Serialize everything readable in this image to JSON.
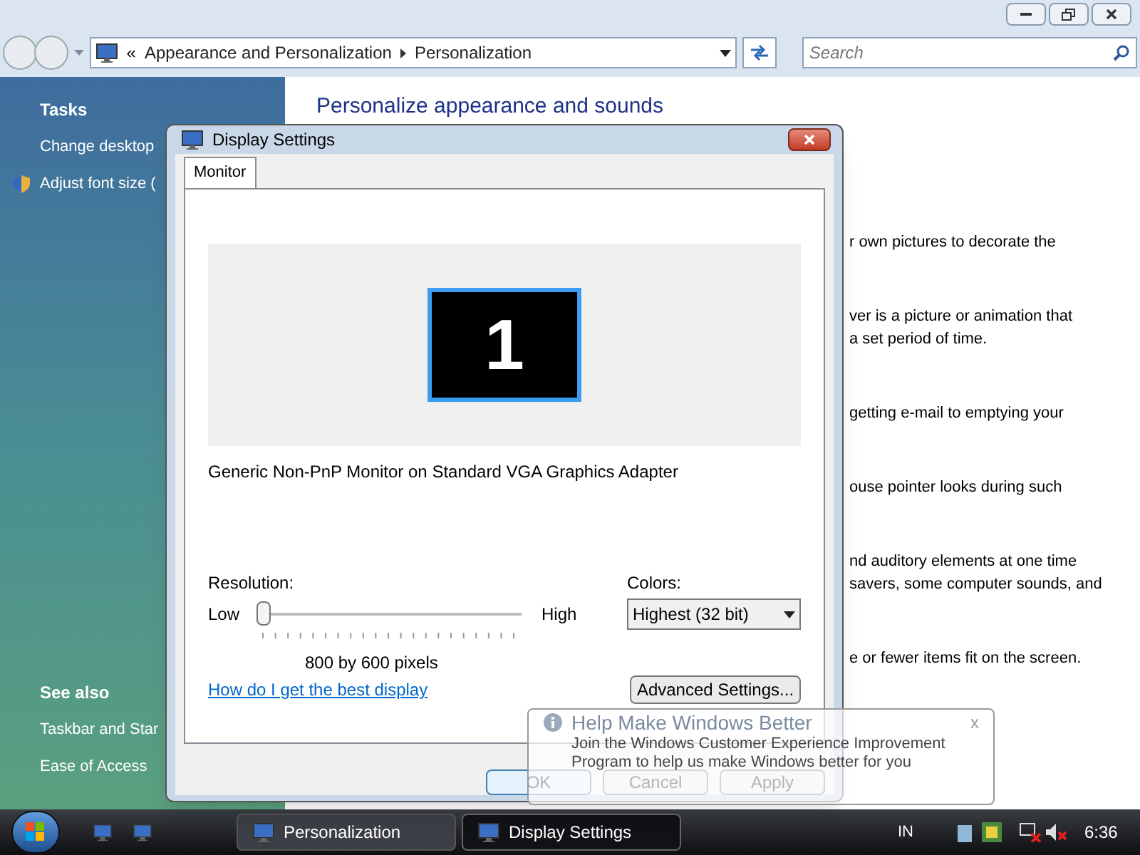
{
  "window": {
    "breadcrumb": [
      {
        "label": "Appearance and Personalization"
      },
      {
        "label": "Personalization"
      }
    ],
    "back_symbol": "«",
    "search": {
      "placeholder": "Search"
    }
  },
  "sidebar": {
    "tasks_heading": "Tasks",
    "tasks": [
      {
        "label": "Change desktop",
        "kind": "link"
      },
      {
        "label": "Adjust font size (",
        "kind": "shield"
      }
    ],
    "see_also_heading": "See also",
    "see_also": [
      {
        "label": "Taskbar and Star"
      },
      {
        "label": "Ease of Access"
      }
    ]
  },
  "content": {
    "heading": "Personalize appearance and sounds",
    "fragments": [
      {
        "lines": [
          "r own pictures to decorate the"
        ]
      },
      {
        "lines": [
          "ver is a picture or animation that",
          "a set period of time."
        ]
      },
      {
        "lines": [
          "getting e-mail to emptying your"
        ]
      },
      {
        "lines": [
          "ouse pointer looks during such"
        ]
      },
      {
        "lines": [
          "nd auditory elements at one time",
          "savers, some computer sounds, and"
        ]
      },
      {
        "lines": [
          "e or fewer items fit on the screen."
        ]
      }
    ]
  },
  "dialog": {
    "title": "Display Settings",
    "tabs": [
      {
        "label": "Monitor",
        "selected": true
      }
    ],
    "monitor_number": "1",
    "monitor_name": "Generic Non-PnP Monitor on Standard VGA Graphics Adapter",
    "resolution": {
      "label": "Resolution:",
      "low": "Low",
      "high": "High",
      "level": 0,
      "reading": "800 by 600 pixels"
    },
    "colors": {
      "label": "Colors:",
      "value": "Highest (32 bit)"
    },
    "help_link": "How do I get the best display",
    "advanced_button": "Advanced Settings...",
    "buttons": [
      {
        "label": "OK",
        "default": true
      },
      {
        "label": "Cancel",
        "default": false
      },
      {
        "label": "Apply",
        "default": false
      }
    ]
  },
  "balloon": {
    "title": "Help Make Windows Better",
    "body": [
      "Join the Windows Customer Experience Improvement",
      "Program to help us make Windows better for you"
    ],
    "close": "x"
  },
  "taskbar": {
    "items": [
      {
        "label": "Personalization",
        "selected": false
      },
      {
        "label": "Display Settings",
        "selected": true
      }
    ],
    "language": "IN",
    "time": "6:36"
  }
}
